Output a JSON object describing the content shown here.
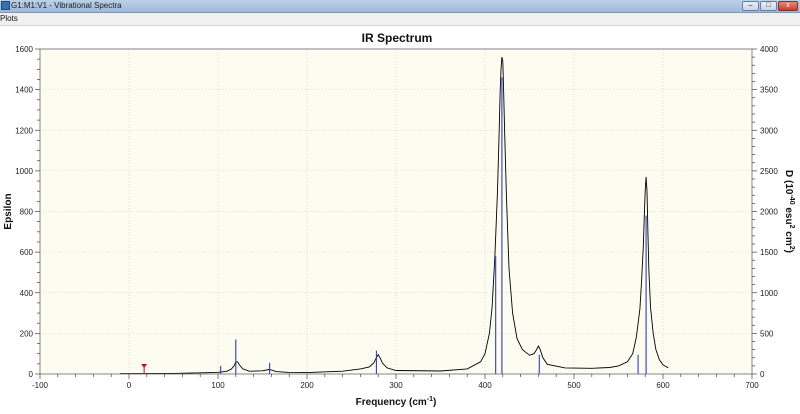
{
  "window": {
    "title": "G1:M1:V1 - Vibrational Spectra",
    "buttons": {
      "minimize": "–",
      "maximize": "□",
      "close": "x"
    }
  },
  "menu": {
    "items": [
      "Plots"
    ]
  },
  "colors": {
    "plot_background": "#fcfcf1",
    "spectrum_line": "#000000",
    "stick_line": "#2f3fb5",
    "marker": "#c0140f"
  },
  "chart_data": {
    "type": "line",
    "title": "IR Spectrum",
    "xlabel": "Frequency (cm-1)",
    "ylabel": "Epsilon",
    "y2label": "D (10-40 esu2 cm2)",
    "xlim": [
      -100,
      700
    ],
    "ylim": [
      0,
      1600
    ],
    "y2lim": [
      0,
      4000
    ],
    "grid": true,
    "x_ticks": [
      -100,
      0,
      100,
      200,
      300,
      400,
      500,
      600,
      700
    ],
    "y_ticks": [
      0,
      200,
      400,
      600,
      800,
      1000,
      1200,
      1400,
      1600
    ],
    "y2_ticks": [
      0,
      500,
      1000,
      1500,
      2000,
      2500,
      3000,
      3500,
      4000
    ],
    "series": [
      {
        "kind": "curve",
        "x": [
          -10,
          50,
          100,
          110,
          115,
          118,
          120,
          122,
          124,
          128,
          135,
          150,
          157,
          160,
          165,
          180,
          200,
          240,
          260,
          270,
          275,
          278,
          280,
          282,
          285,
          290,
          300,
          350,
          380,
          395,
          400,
          405,
          408,
          411,
          414,
          416,
          417,
          418,
          419,
          420,
          421,
          422,
          424,
          427,
          431,
          436,
          442,
          450,
          455,
          458,
          460,
          462,
          465,
          470,
          490,
          520,
          540,
          550,
          560,
          566,
          570,
          574,
          576,
          578,
          579,
          580,
          581,
          582,
          583,
          584,
          586,
          589,
          592,
          596,
          600,
          606
        ],
        "y": [
          2,
          3,
          8,
          14,
          24,
          40,
          60,
          60,
          45,
          25,
          14,
          16,
          22,
          20,
          12,
          8,
          7,
          14,
          25,
          35,
          55,
          80,
          95,
          80,
          52,
          30,
          17,
          15,
          25,
          60,
          100,
          200,
          330,
          570,
          900,
          1200,
          1380,
          1500,
          1560,
          1540,
          1380,
          1200,
          880,
          520,
          300,
          175,
          120,
          92,
          100,
          120,
          138,
          120,
          80,
          48,
          30,
          28,
          32,
          40,
          60,
          100,
          180,
          320,
          460,
          640,
          780,
          900,
          970,
          900,
          700,
          520,
          330,
          200,
          120,
          70,
          45,
          30
        ]
      },
      {
        "kind": "sticks",
        "x": [
          103,
          120,
          158,
          278,
          412,
          419,
          461,
          572,
          581
        ],
        "y": [
          40,
          170,
          55,
          115,
          580,
          1460,
          95,
          95,
          780
        ]
      }
    ],
    "annotations": [
      {
        "kind": "marker",
        "x": 17,
        "y": 20
      }
    ]
  }
}
